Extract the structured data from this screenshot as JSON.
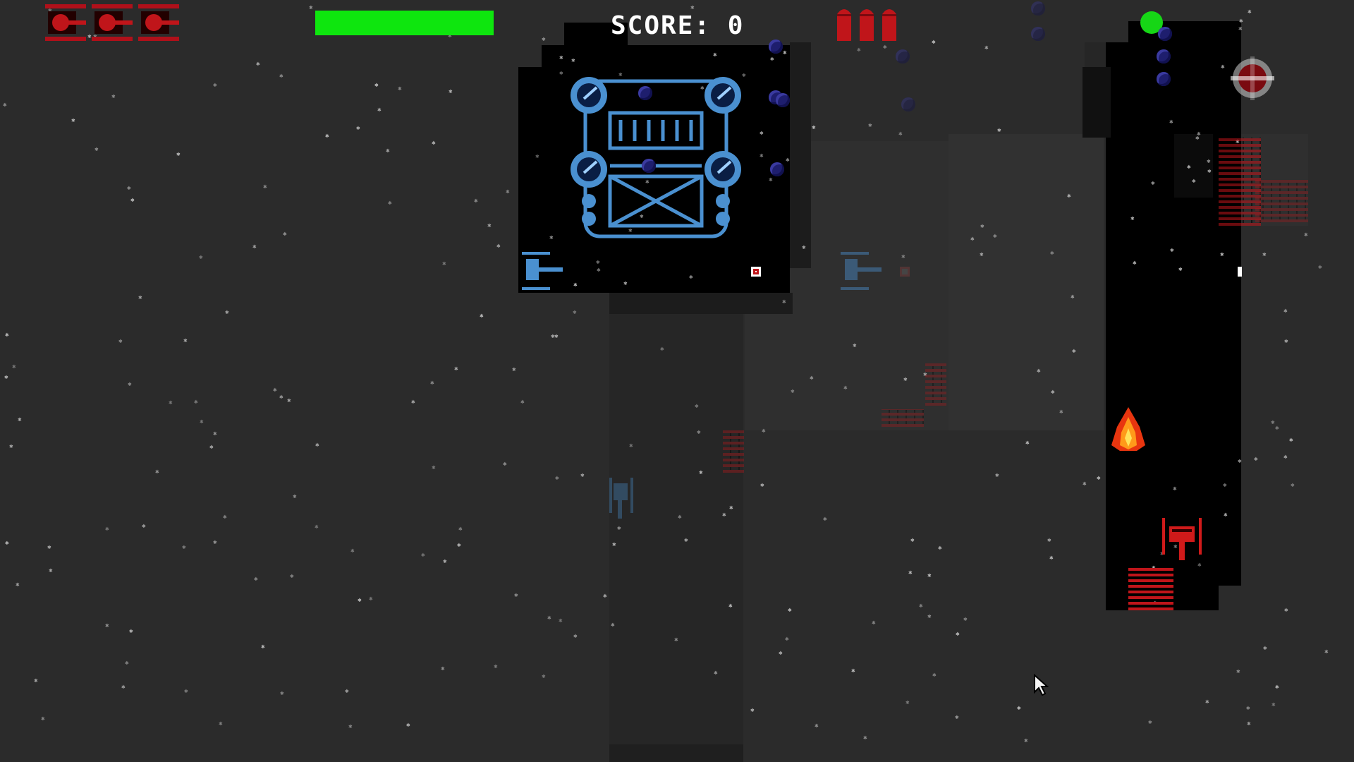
{
  "hud": {
    "lives": {
      "count": 3,
      "icon": "red-tank-icon"
    },
    "health": {
      "value_fraction": 1.0,
      "color": "#0ee60e"
    },
    "score_label": "SCORE: 0",
    "ammo": {
      "count": 3,
      "icon": "red-shell-icon"
    },
    "status_indicator": {
      "color": "#16d616"
    }
  },
  "entities": {
    "boss": {
      "name": "blue-fortress-boss-icon",
      "color": "#4a90d0"
    },
    "player_tank": {
      "name": "red-tank-icon",
      "color": "#d01a1a"
    },
    "enemy_turrets": [
      "blue-turret-icon",
      "blue-turret-icon",
      "blue-turret-icon"
    ],
    "fire": {
      "name": "fire-icon"
    },
    "mine": {
      "name": "red-mine-icon"
    },
    "orbs": {
      "name": "purple-orb-icon",
      "color": "#1e1e6e"
    }
  },
  "colors": {
    "background": "#2b2b2b",
    "revealed_area": "#000000",
    "brick": "#c0151a"
  }
}
